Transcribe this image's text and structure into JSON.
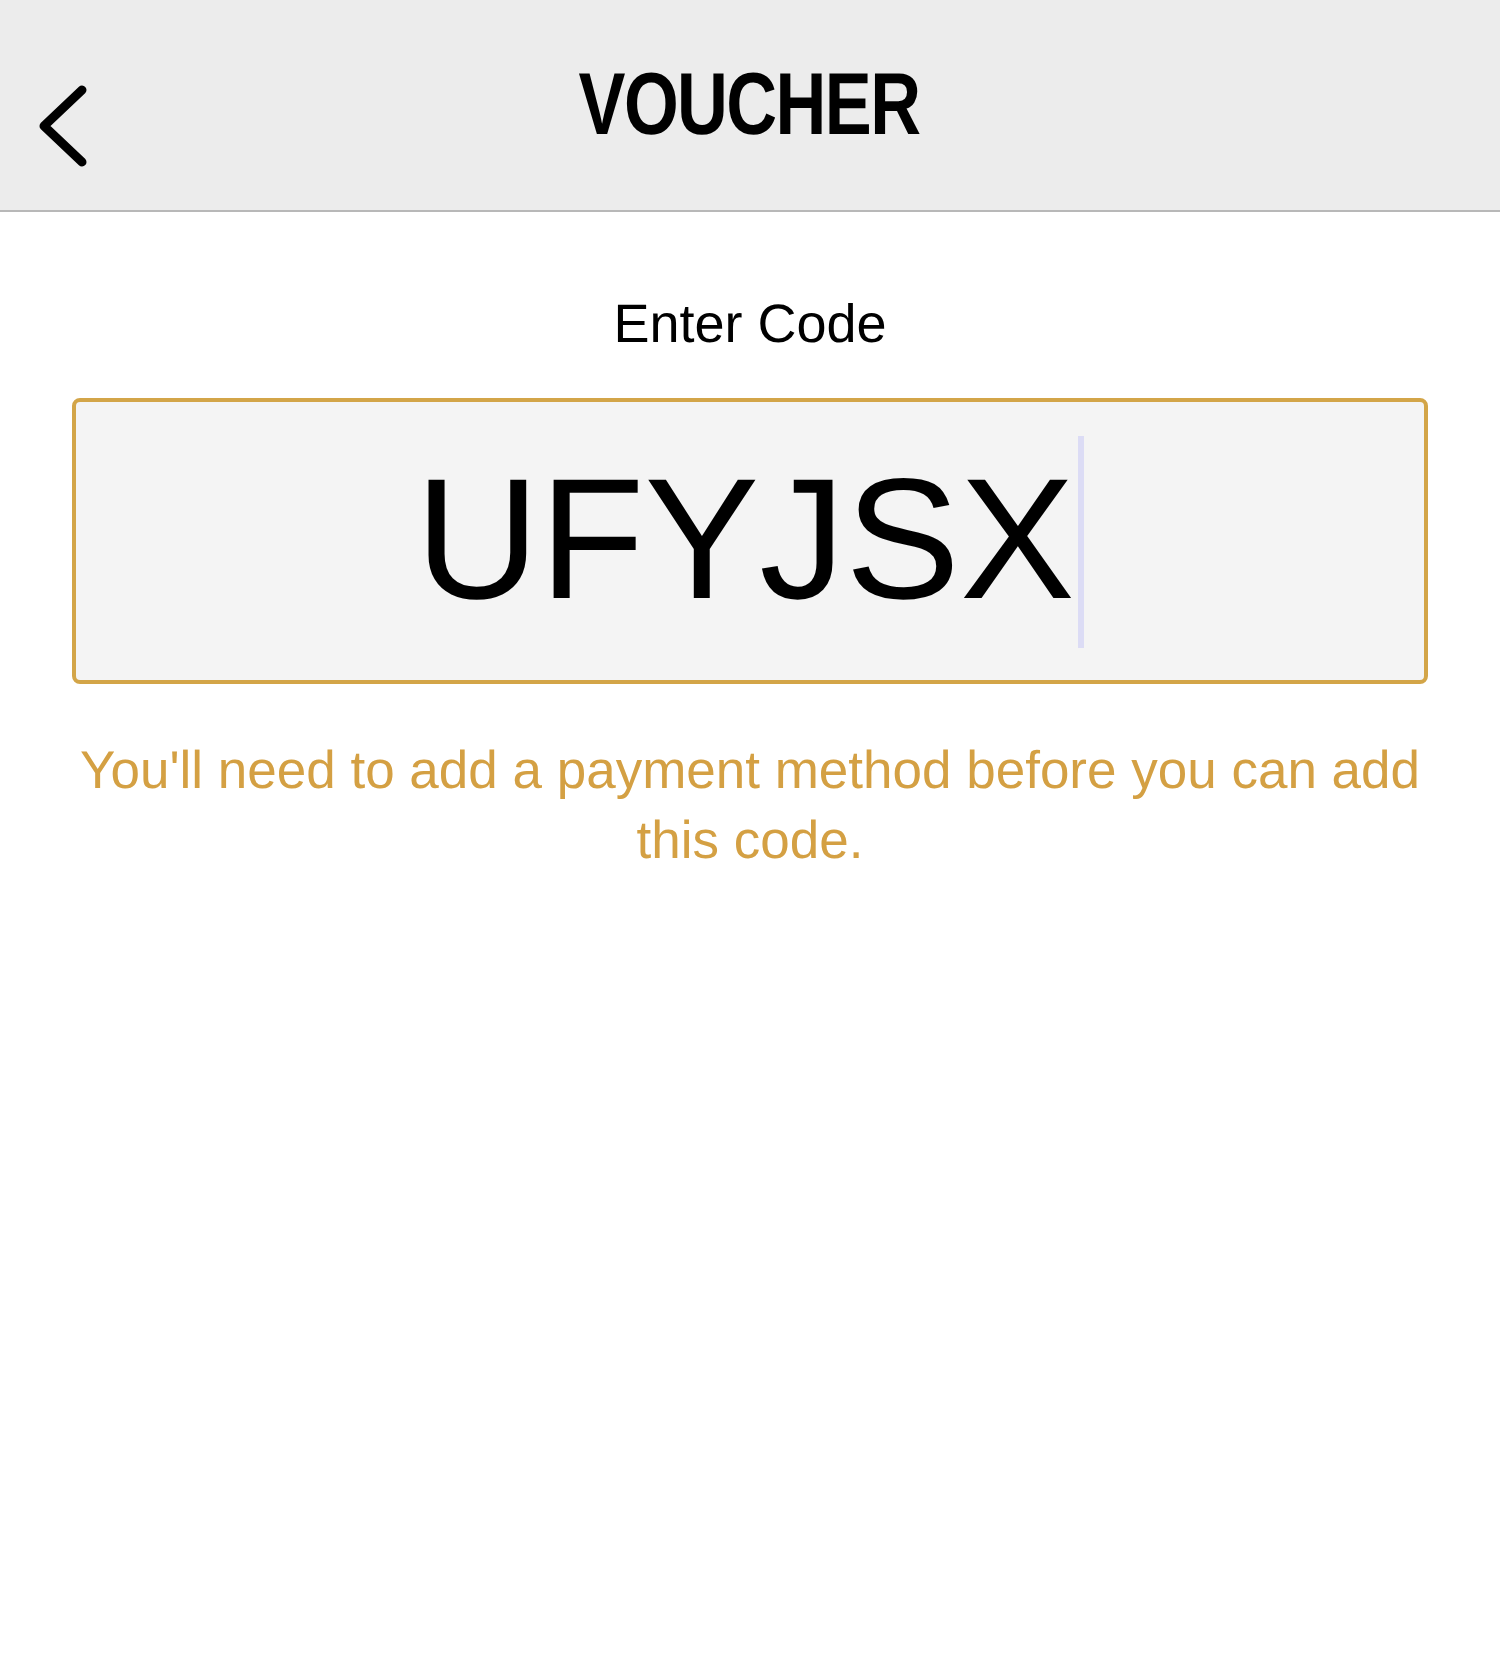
{
  "header": {
    "title": "VOUCHER"
  },
  "code_field": {
    "label": "Enter Code",
    "value": "UFYJSX",
    "focused": true
  },
  "message": "You'll need to add a payment method before you can add this code."
}
